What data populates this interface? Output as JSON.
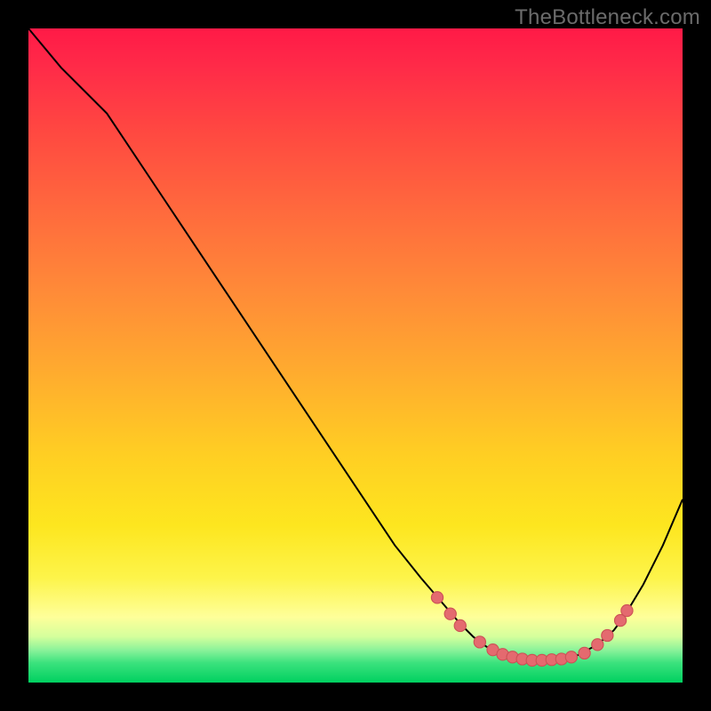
{
  "attribution": "TheBottleneck.com",
  "colors": {
    "frame": "#000000",
    "attribution_text": "#6b6b6b",
    "curve": "#000000",
    "marker_fill": "#e46a6f",
    "marker_stroke": "#cc5156",
    "gradient_stops": [
      "#ff1a47",
      "#ff2b48",
      "#ff4941",
      "#ff6a3d",
      "#ff8a38",
      "#ffaa2f",
      "#ffce23",
      "#fde61f",
      "#fdf44a",
      "#feff9a",
      "#d4ff9c",
      "#8cf39a",
      "#3be27d",
      "#00d060"
    ]
  },
  "chart_data": {
    "type": "line",
    "title": "",
    "xlabel": "",
    "ylabel": "",
    "xlim": [
      0,
      100
    ],
    "ylim": [
      0,
      100
    ],
    "note": "x and y in 0–100 plot-area units (0,0 = top-left of colored square); y smaller = higher bottleneck mismatch (red), y near 100 = ideal (green).",
    "curve_xy": [
      [
        0,
        0
      ],
      [
        5,
        6
      ],
      [
        8,
        9
      ],
      [
        12,
        13
      ],
      [
        20,
        25
      ],
      [
        30,
        40
      ],
      [
        40,
        55
      ],
      [
        50,
        70
      ],
      [
        56,
        79
      ],
      [
        60,
        84
      ],
      [
        63,
        87.5
      ],
      [
        66,
        91
      ],
      [
        68,
        93
      ],
      [
        70,
        94.5
      ],
      [
        72,
        95.5
      ],
      [
        75,
        96.3
      ],
      [
        78,
        96.6
      ],
      [
        81,
        96.5
      ],
      [
        84,
        95.8
      ],
      [
        87,
        94.2
      ],
      [
        89.5,
        92
      ],
      [
        91,
        90
      ],
      [
        94,
        85
      ],
      [
        97,
        79
      ],
      [
        100,
        72
      ]
    ],
    "markers_xy": [
      [
        62.5,
        87
      ],
      [
        64.5,
        89.5
      ],
      [
        66.0,
        91.3
      ],
      [
        69.0,
        93.8
      ],
      [
        71.0,
        95.0
      ],
      [
        72.5,
        95.7
      ],
      [
        74.0,
        96.1
      ],
      [
        75.5,
        96.4
      ],
      [
        77.0,
        96.6
      ],
      [
        78.5,
        96.6
      ],
      [
        80.0,
        96.5
      ],
      [
        81.5,
        96.4
      ],
      [
        83.0,
        96.1
      ],
      [
        85.0,
        95.5
      ],
      [
        87.0,
        94.2
      ],
      [
        88.5,
        92.8
      ],
      [
        90.5,
        90.5
      ],
      [
        91.5,
        89.0
      ]
    ]
  }
}
